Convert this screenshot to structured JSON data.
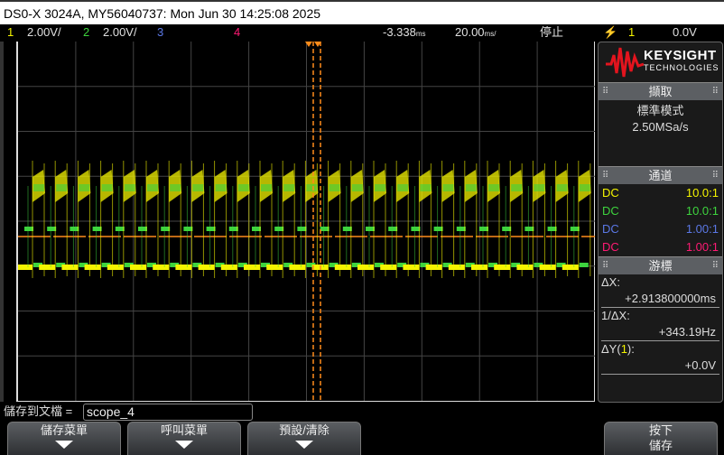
{
  "title": "DS0-X 3024A, MY56040737: Mon Jun 30 14:25:08 2025",
  "channels": [
    {
      "num": "1",
      "scale": "2.00V/"
    },
    {
      "num": "2",
      "scale": "2.00V/"
    },
    {
      "num": "3"
    },
    {
      "num": "4"
    }
  ],
  "timebase": {
    "delay": "-3.338",
    "delay_unit": "ms",
    "scale": "20.00",
    "scale_unit": "ms/",
    "status": "停止"
  },
  "trigger": {
    "source": "1",
    "level": "0.0V"
  },
  "brand": {
    "name": "KEYSIGHT",
    "sub": "TECHNOLOGIES"
  },
  "acquire": {
    "header": "擷取",
    "mode": "標準模式",
    "rate": "2.50MSa/s"
  },
  "channel_panel": {
    "header": "通道",
    "rows": [
      {
        "coupling": "DC",
        "probe": "10.0:1"
      },
      {
        "coupling": "DC",
        "probe": "10.0:1"
      },
      {
        "coupling": "DC",
        "probe": "1.00:1"
      },
      {
        "coupling": "DC",
        "probe": "1.00:1"
      }
    ]
  },
  "cursors": {
    "header": "游標",
    "dx_label": "ΔX:",
    "dx": "+2.913800000ms",
    "inv_label": "1/ΔX:",
    "inv": "+343.19Hz",
    "dy_label_pre": "ΔY(",
    "dy_ch": "1",
    "dy_label_post": "):",
    "dy": "+0.0V"
  },
  "save": {
    "label": "儲存到文檔 =",
    "filename": "scope_4"
  },
  "softkeys": [
    {
      "label": "儲存菜單"
    },
    {
      "label": "呼叫菜單"
    },
    {
      "label": "預設/清除"
    },
    {
      "label": "按下",
      "label2": "儲存"
    }
  ],
  "colors": {
    "ch1": "#f4f400",
    "ch2": "#3ed43e",
    "ch3": "#5b78e6",
    "ch4": "#ff1a74",
    "cursor": "#ff8c1a"
  }
}
